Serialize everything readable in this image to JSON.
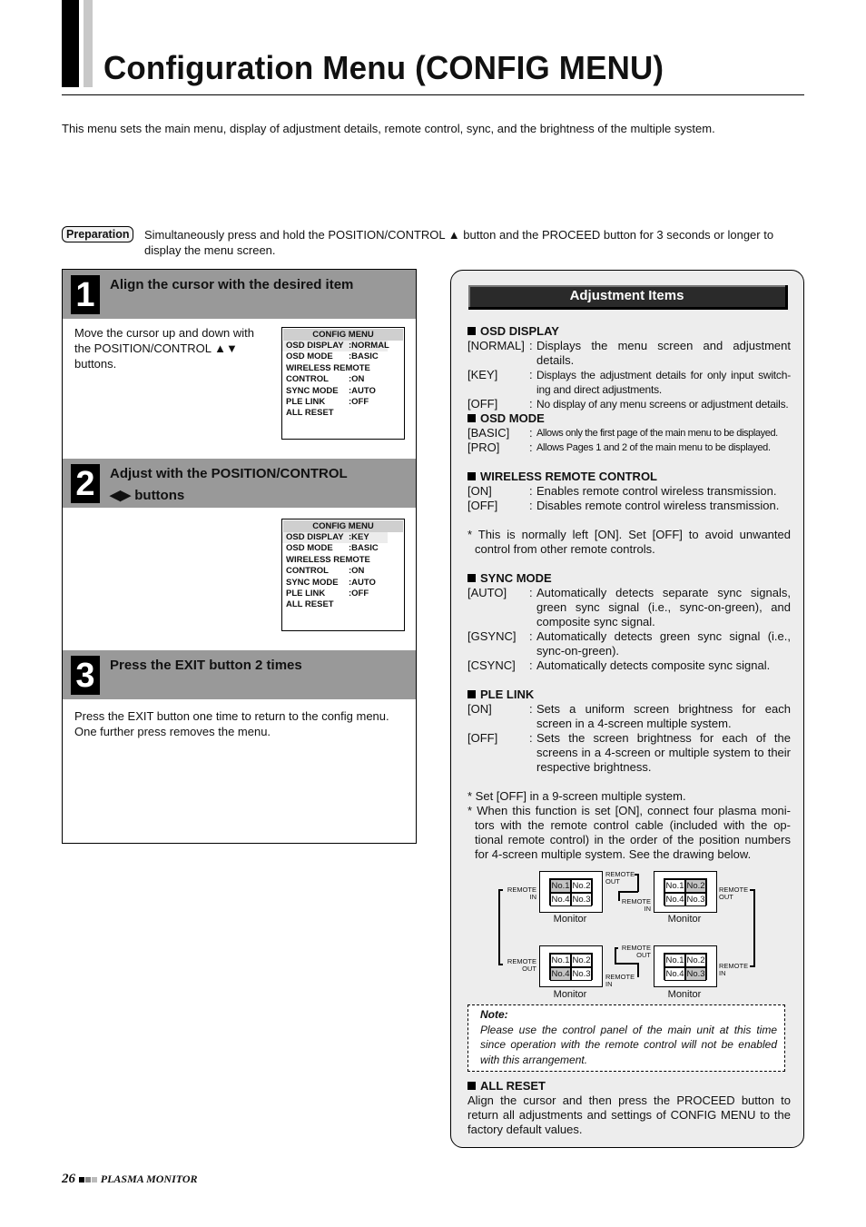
{
  "header": {
    "title": "Configuration Menu (CONFIG MENU)",
    "intro": "This menu sets the main menu, display of adjustment details, remote control, sync, and the brightness of the multiple system."
  },
  "preparation": {
    "badge": "Preparation",
    "text": "Simultaneously press and hold the POSITION/CONTROL ▲ button and the PROCEED button for 3 seconds or longer to display the menu screen."
  },
  "steps": [
    {
      "number": "1",
      "title": "Align the cursor with the desired item",
      "body": "Move the cursor up and down with the POSITION/CONTROL ▲▼ buttons.",
      "osd": {
        "title": "CONFIG MENU",
        "rows": [
          {
            "label": "OSD DISPLAY",
            "value": ":NORMAL",
            "highlight": true
          },
          {
            "label": "OSD MODE",
            "value": ":BASIC"
          },
          {
            "label": "WIRELESS REMOTE",
            "value": ""
          },
          {
            "label": "CONTROL",
            "value": ":ON"
          },
          {
            "label": "SYNC MODE",
            "value": ":AUTO"
          },
          {
            "label": "PLE LINK",
            "value": ":OFF"
          },
          {
            "label": "ALL RESET",
            "value": ""
          }
        ]
      }
    },
    {
      "number": "2",
      "title_line1": "Adjust with the POSITION/CONTROL",
      "title_line2": "◀▶ buttons",
      "osd": {
        "title": "CONFIG MENU",
        "rows": [
          {
            "label": "OSD DISPLAY",
            "value": ":KEY",
            "highlight": true
          },
          {
            "label": "OSD MODE",
            "value": ":BASIC"
          },
          {
            "label": "WIRELESS REMOTE",
            "value": ""
          },
          {
            "label": "CONTROL",
            "value": ":ON"
          },
          {
            "label": "SYNC MODE",
            "value": ":AUTO"
          },
          {
            "label": "PLE LINK",
            "value": ":OFF"
          },
          {
            "label": "ALL RESET",
            "value": ""
          }
        ]
      }
    },
    {
      "number": "3",
      "title": "Press the EXIT button 2 times",
      "body": "Press the EXIT button one time to return to the config menu. One further press removes the menu."
    }
  ],
  "adjustment": {
    "heading": "Adjustment Items",
    "osd_display": {
      "title": "OSD DISPLAY",
      "options": [
        {
          "key": "[NORMAL]",
          "desc": "Displays the menu screen and adjustment details."
        },
        {
          "key": "[KEY]",
          "desc": "Displays the adjustment details for only input switch-ing and direct adjustments."
        },
        {
          "key": "[OFF]",
          "desc": "No display of any menu screens or adjustment details."
        }
      ]
    },
    "osd_mode": {
      "title": "OSD MODE",
      "options": [
        {
          "key": "[BASIC]",
          "desc": "Allows only the first page of the main menu to be displayed."
        },
        {
          "key": "[PRO]",
          "desc": "Allows Pages 1 and 2 of the main menu to be displayed."
        }
      ]
    },
    "wireless": {
      "title": "WIRELESS REMOTE CONTROL",
      "options": [
        {
          "key": "[ON]",
          "desc": "Enables remote control wireless transmission."
        },
        {
          "key": "[OFF]",
          "desc": "Disables remote control wireless transmission."
        }
      ],
      "note": "* This is normally left [ON]. Set [OFF] to avoid unwanted control from other remote controls."
    },
    "sync_mode": {
      "title": "SYNC MODE",
      "options": [
        {
          "key": "[AUTO]",
          "desc": "Automatically detects separate sync signals, green sync signal (i.e., sync-on-green), and composite sync signal."
        },
        {
          "key": "[GSYNC]",
          "desc": "Automatically detects green sync signal (i.e., sync-on-green)."
        },
        {
          "key": "[CSYNC]",
          "desc": "Automatically detects composite sync signal."
        }
      ]
    },
    "ple_link": {
      "title": "PLE LINK",
      "options": [
        {
          "key": "[ON]",
          "desc": "Sets a uniform screen brightness for each screen in a 4-screen multiple system."
        },
        {
          "key": "[OFF]",
          "desc": "Sets the screen brightness for each of the screens in a 4-screen or multiple system to their respective brightness."
        }
      ],
      "note1": "* Set [OFF] in a 9-screen multiple system.",
      "note2": "* When this function is set [ON], connect four plasma moni-tors with the remote control cable (included with the op-tional remote control) in the order of the position numbers for 4-screen multiple system. See the drawing below."
    },
    "diagram": {
      "cells": [
        "No.1",
        "No.2",
        "No.4",
        "No.3"
      ],
      "monitor_label": "Monitor",
      "remote_in": "REMOTE IN",
      "remote_out": "REMOTE OUT",
      "monitors": [
        {
          "position": "top-left",
          "highlighted": "No.1"
        },
        {
          "position": "top-right",
          "highlighted": "No.2"
        },
        {
          "position": "bottom-left",
          "highlighted": "No.4"
        },
        {
          "position": "bottom-right",
          "highlighted": "No.3"
        }
      ]
    },
    "note_box": {
      "title": "Note:",
      "text": "Please use the control panel of the main unit at this time since operation with the remote control will not be enabled with this arrangement."
    },
    "all_reset": {
      "title": "ALL RESET",
      "text": "Align the cursor and then press the PROCEED button to return all adjustments and settings of CONFIG MENU to the factory default values."
    }
  },
  "footer": {
    "page_number": "26",
    "product": "PLASMA MONITOR"
  }
}
